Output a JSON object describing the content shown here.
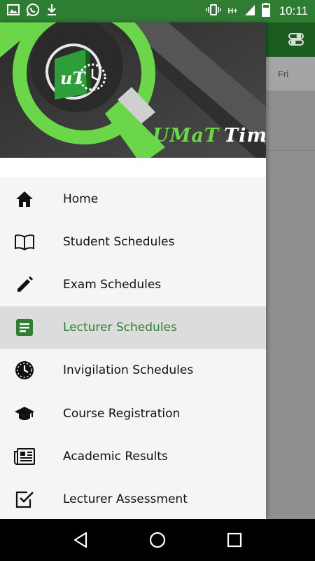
{
  "status_bar": {
    "time": "10:11",
    "network": "H+",
    "icons": [
      "gallery-icon",
      "whatsapp-icon",
      "download-icon",
      "vibrate-icon",
      "signal-icon",
      "battery-icon"
    ]
  },
  "drawer": {
    "brand": {
      "part1": "UMaT",
      "part2": "Times"
    },
    "logo_text": "uT",
    "menu": [
      {
        "label": "Home",
        "icon": "home-icon",
        "active": false
      },
      {
        "label": "Student Schedules",
        "icon": "book-icon",
        "active": false
      },
      {
        "label": "Exam Schedules",
        "icon": "pencil-icon",
        "active": false
      },
      {
        "label": "Lecturer Schedules",
        "icon": "document-icon",
        "active": true
      },
      {
        "label": "Invigilation Schedules",
        "icon": "clock-icon",
        "active": false
      },
      {
        "label": "Course Registration",
        "icon": "graduation-cap-icon",
        "active": false
      },
      {
        "label": "Academic Results",
        "icon": "newspaper-icon",
        "active": false
      },
      {
        "label": "Lecturer Assessment",
        "icon": "checkbox-icon",
        "active": false
      }
    ]
  },
  "background_app": {
    "day_label": "Fri"
  },
  "colors": {
    "primary": "#2e7d32",
    "primary_dark": "#1b5e20",
    "accent": "#6bd64a"
  }
}
